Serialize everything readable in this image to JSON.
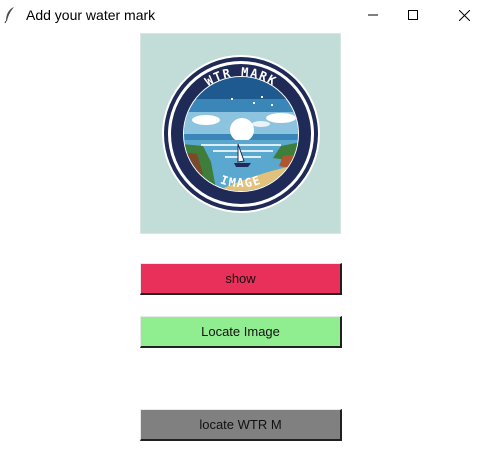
{
  "window": {
    "title": "Add your water mark",
    "app_icon": "feather-icon",
    "controls": [
      "minimize-icon",
      "maximize-icon",
      "close-icon"
    ]
  },
  "preview": {
    "badge_text_top": "WTR MARK",
    "badge_text_bottom": "IMAGE",
    "background_color": "#c2dcd8"
  },
  "buttons": {
    "show": {
      "label": "show",
      "color": "#e8305a"
    },
    "locate_image": {
      "label": "Locate Image",
      "color": "#90ee90"
    },
    "locate_wtr": {
      "label": "locate WTR M",
      "color": "#808080"
    }
  }
}
